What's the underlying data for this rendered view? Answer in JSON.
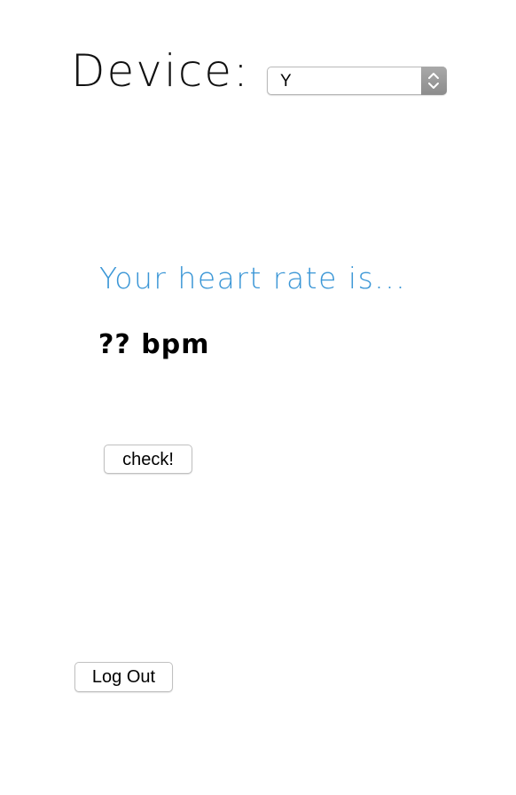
{
  "device": {
    "label": "Device:",
    "selected": "Y"
  },
  "heart_rate": {
    "title": "Your heart rate is...",
    "value": "?? bpm"
  },
  "actions": {
    "check_label": "check!",
    "logout_label": "Log Out"
  },
  "colors": {
    "title_accent": "#3a96d6",
    "select_arrow_bg": "#999999"
  },
  "icons": {
    "select_arrows": "chevron-up-down-icon"
  }
}
